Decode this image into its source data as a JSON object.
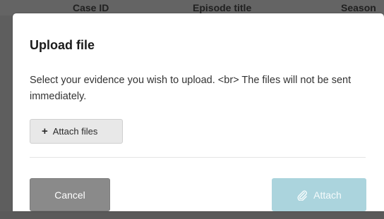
{
  "background_table": {
    "columns": [
      "Case ID",
      "Episode title",
      "Season"
    ]
  },
  "modal": {
    "title": "Upload file",
    "description": "Select your evidence you wish to upload. <br> The files will not be sent immediately.",
    "attach_files_label": "Attach files",
    "attach_files_icon": "plus-icon",
    "cancel_label": "Cancel",
    "attach_label": "Attach",
    "attach_icon": "paperclip-icon",
    "attach_enabled": false
  },
  "colors": {
    "overlay": "#5e5e5e",
    "attach_button_disabled": "#abd4dd",
    "cancel_button": "#8a8a8a",
    "attach_files_button": "#e8e8e8"
  }
}
